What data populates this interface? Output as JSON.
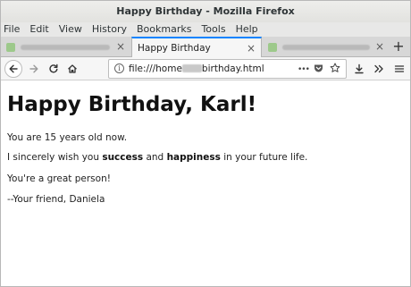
{
  "window": {
    "title": "Happy Birthday - Mozilla Firefox"
  },
  "menu": [
    "File",
    "Edit",
    "View",
    "History",
    "Bookmarks",
    "Tools",
    "Help"
  ],
  "tabs": {
    "active_title": "Happy Birthday"
  },
  "urlbar": {
    "url_prefix": "file:///home",
    "url_suffix": "birthday.html",
    "more_label": "•••"
  },
  "toolbar_icons": {
    "back": "arrow-left-icon",
    "forward": "arrow-right-icon",
    "reload": "reload-icon",
    "home": "home-icon",
    "pocket": "pocket-icon",
    "bookmark": "star-icon",
    "downloads": "download-icon",
    "overflow": "chevron-double-right-icon",
    "menu": "hamburger-icon"
  },
  "colors": {
    "accent": "#0a84ff"
  },
  "page": {
    "heading": "Happy Birthday, Karl!",
    "age_line": "You are 15 years old now.",
    "wish": {
      "before": "I sincerely wish you ",
      "bold1": "success",
      "middle": " and ",
      "bold2": "happiness",
      "after": " in your future life."
    },
    "great_person": "You're a great person!",
    "signature": "--Your friend, Daniela"
  }
}
